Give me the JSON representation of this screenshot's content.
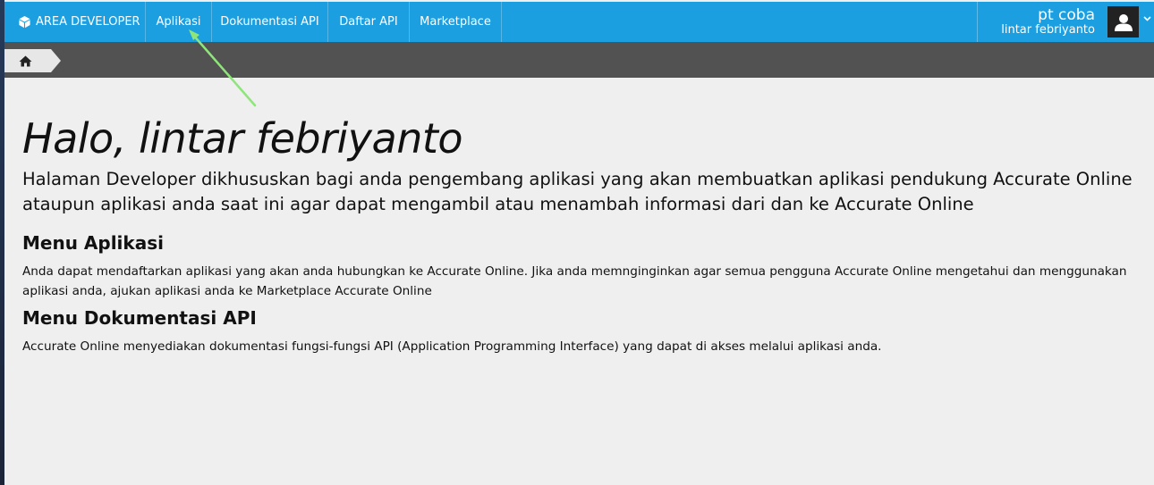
{
  "navbar": {
    "brand_icon": "cube-icon",
    "brand": "AREA DEVELOPER",
    "items": [
      {
        "label": "Aplikasi"
      },
      {
        "label": "Dokumentasi API"
      },
      {
        "label": "Daftar API"
      },
      {
        "label": "Marketplace"
      }
    ],
    "user": {
      "company": "pt coba",
      "name": "lintar febriyanto",
      "avatar_icon": "user-icon",
      "dropdown_icon": "chevron-down-icon"
    }
  },
  "breadcrumb": {
    "home_icon": "home-icon"
  },
  "main": {
    "greeting": "Halo, lintar febriyanto",
    "intro": "Halaman Developer dikhususkan bagi anda pengembang aplikasi yang akan membuatkan aplikasi pendukung Accurate Online ataupun aplikasi anda saat ini agar dapat mengambil atau menambah informasi dari dan ke Accurate Online",
    "sections": [
      {
        "title": "Menu Aplikasi",
        "body": "Anda dapat mendaftarkan aplikasi yang akan anda hubungkan ke Accurate Online. Jika anda memnginginkan agar semua pengguna Accurate Online mengetahui dan menggunakan aplikasi anda, ajukan aplikasi anda ke Marketplace Accurate Online"
      },
      {
        "title": "Menu Dokumentasi API",
        "body": "Accurate Online menyediakan dokumentasi fungsi-fungsi API (Application Programming Interface) yang dapat di akses melalui aplikasi anda."
      }
    ]
  },
  "annotation": {
    "arrow_color": "#8ee67a"
  },
  "colors": {
    "navbar": "#1b9fe1",
    "breadcrumb_bar": "#525252",
    "page_background": "#efefef"
  }
}
